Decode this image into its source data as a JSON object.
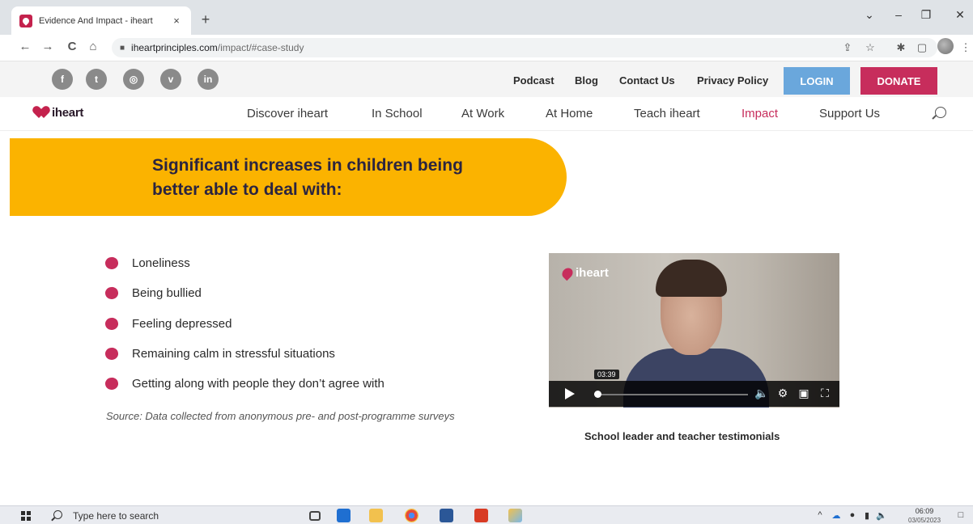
{
  "browser": {
    "tab_title": "Evidence And Impact - iheart",
    "tab_close": "×",
    "new_tab": "+",
    "window_controls": [
      "⌄",
      "–",
      "❐",
      "✕"
    ],
    "nav": {
      "back": "←",
      "forward": "→",
      "reload": "C",
      "home": "⌂"
    },
    "url_host": "iheartprinciples.com",
    "url_path": "/impact/#case-study",
    "toolbar_icons": [
      "⇪",
      "☆",
      "✱",
      "▢",
      "⋮"
    ]
  },
  "utility_bar": {
    "social": [
      {
        "name": "facebook-icon",
        "glyph": "f"
      },
      {
        "name": "twitter-icon",
        "glyph": "t"
      },
      {
        "name": "instagram-icon",
        "glyph": "◎"
      },
      {
        "name": "vimeo-icon",
        "glyph": "v"
      },
      {
        "name": "linkedin-icon",
        "glyph": "in"
      }
    ],
    "links": [
      "Podcast",
      "Blog",
      "Contact Us",
      "Privacy Policy"
    ],
    "login": "LOGIN",
    "donate": "DONATE",
    "login_color": "#6aa7dc",
    "donate_color": "#c72d5c"
  },
  "main_nav": {
    "logo_text": "iheart",
    "items": [
      "Discover iheart",
      "In School",
      "At Work",
      "At Home",
      "Teach iheart",
      "Impact",
      "Support Us"
    ],
    "active": "Impact"
  },
  "hero": {
    "line1": "Significant increases in children being",
    "line2": "better able to deal with:",
    "banner_color": "#fbb300"
  },
  "bullets": [
    "Loneliness",
    "Being bullied",
    "Feeling depressed",
    "Remaining calm in stressful situations",
    "Getting along with people they don’t agree with"
  ],
  "source_note": "Source: Data collected from anonymous pre- and post-programme surveys",
  "video": {
    "logo_text": "iheart",
    "time": "03:39",
    "caption": "School leader and teacher testimonials"
  },
  "taskbar": {
    "search_placeholder": "Type here to search",
    "time": "06:09",
    "date": "03/05/2023"
  }
}
